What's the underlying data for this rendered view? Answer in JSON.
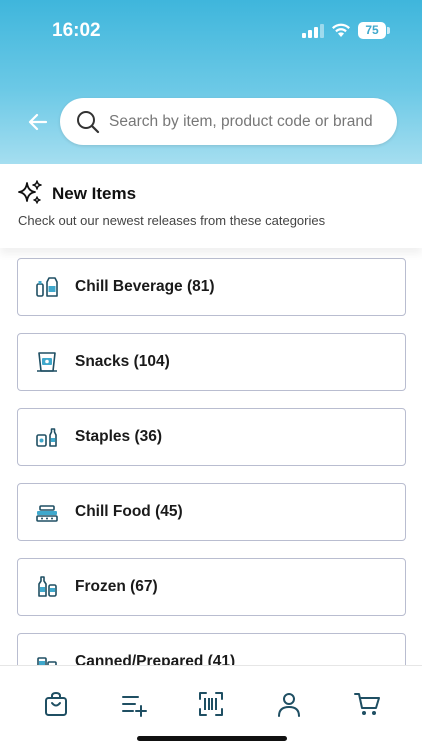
{
  "status_bar": {
    "time": "16:02",
    "battery": "75"
  },
  "search": {
    "placeholder": "Search by item, product code or brand"
  },
  "section": {
    "title": "New Items",
    "subtitle": "Check out our newest releases from these categories"
  },
  "categories": [
    {
      "label": "Chill Beverage (81)",
      "icon": "beverage-icon"
    },
    {
      "label": "Snacks (104)",
      "icon": "snacks-icon"
    },
    {
      "label": "Staples (36)",
      "icon": "staples-icon"
    },
    {
      "label": "Chill Food (45)",
      "icon": "chill-food-icon"
    },
    {
      "label": "Frozen (67)",
      "icon": "frozen-icon"
    },
    {
      "label": "Canned/Prepared (41)",
      "icon": "canned-icon"
    }
  ],
  "tab_bar": [
    {
      "icon": "shopping-bag-icon"
    },
    {
      "icon": "add-list-icon"
    },
    {
      "icon": "barcode-scan-icon"
    },
    {
      "icon": "user-icon"
    },
    {
      "icon": "cart-icon"
    }
  ],
  "colors": {
    "header_top": "#3fb6dc",
    "header_bottom": "#a5def0",
    "icon": "#1f4f63",
    "icon_accent": "#3fa8cc",
    "border": "#b9bdd0"
  }
}
